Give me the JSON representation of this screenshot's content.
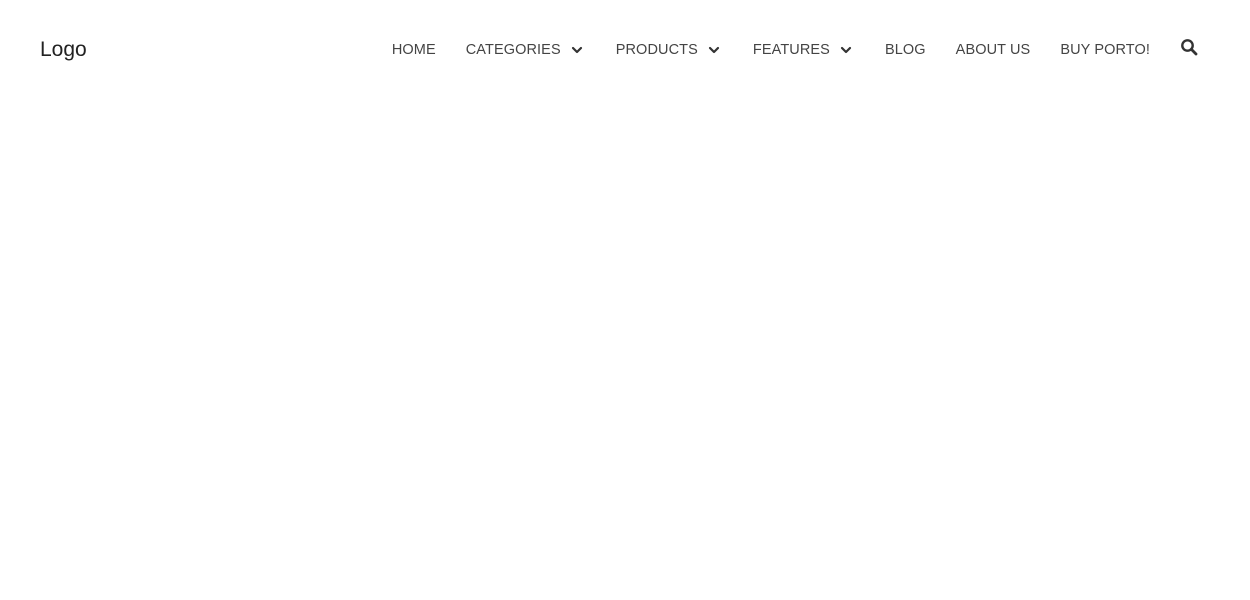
{
  "logo": {
    "text": "Logo"
  },
  "nav": {
    "items": [
      {
        "label": "HOME",
        "has_dropdown": false
      },
      {
        "label": "CATEGORIES",
        "has_dropdown": true
      },
      {
        "label": "PRODUCTS",
        "has_dropdown": true
      },
      {
        "label": "FEATURES",
        "has_dropdown": true
      },
      {
        "label": "BLOG",
        "has_dropdown": false
      },
      {
        "label": "ABOUT US",
        "has_dropdown": false
      },
      {
        "label": "BUY PORTO!",
        "has_dropdown": false
      }
    ],
    "search_icon": "search-icon",
    "dropdown_icon": "chevron-down-icon"
  },
  "colors": {
    "background": "#ffffff",
    "text": "#444444",
    "logo": "#222222"
  }
}
